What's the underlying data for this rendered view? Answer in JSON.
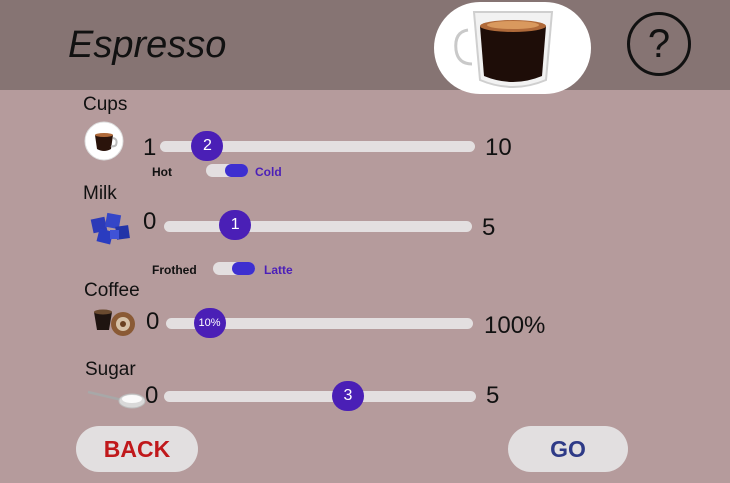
{
  "header": {
    "title": "Espresso",
    "help_symbol": "?"
  },
  "cups": {
    "label": "Cups",
    "min": "1",
    "max": "10",
    "value": "2",
    "fraction": 0.111
  },
  "temperature": {
    "left": "Hot",
    "right": "Cold",
    "selected": "Cold"
  },
  "milk": {
    "label": "Milk",
    "min": "0",
    "max": "5",
    "value": "1",
    "fraction": 0.2
  },
  "milk_style": {
    "left": "Frothed",
    "right": "Latte",
    "selected": "Latte"
  },
  "coffee": {
    "label": "Coffee",
    "min": "0",
    "max": "100%",
    "value": "10%",
    "fraction": 0.1
  },
  "sugar": {
    "label": "Sugar",
    "min": "0",
    "max": "5",
    "value": "3",
    "fraction": 0.6
  },
  "buttons": {
    "back": "BACK",
    "go": "GO"
  },
  "colors": {
    "header_bg": "#867473",
    "page_bg": "#b59b9c",
    "accent": "#4a1fb6",
    "back_text": "#c0181b",
    "go_text": "#2e3a87"
  }
}
